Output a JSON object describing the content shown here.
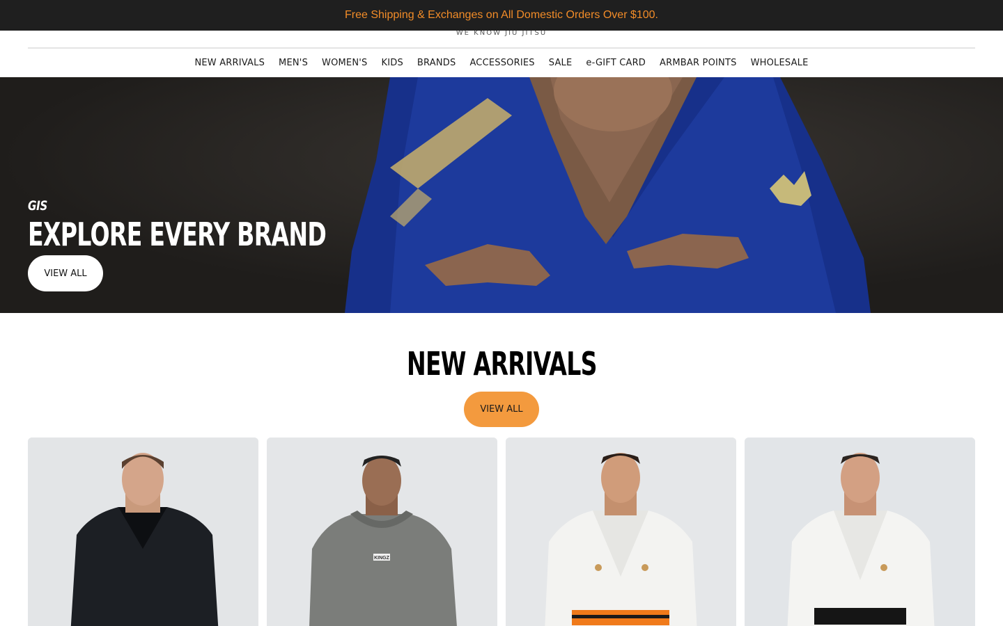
{
  "announcement": {
    "text": "Free Shipping & Exchanges on All Domestic Orders Over $100."
  },
  "brand": {
    "tagline": "WE KNOW JIU JITSU"
  },
  "nav": {
    "items": [
      {
        "label": "NEW ARRIVALS"
      },
      {
        "label": "MEN'S"
      },
      {
        "label": "WOMEN'S"
      },
      {
        "label": "KIDS"
      },
      {
        "label": "BRANDS"
      },
      {
        "label": "ACCESSORIES"
      },
      {
        "label": "SALE"
      },
      {
        "label": "e-GIFT CARD"
      },
      {
        "label": "ARMBAR POINTS"
      },
      {
        "label": "WHOLESALE"
      }
    ]
  },
  "hero": {
    "kicker": "GIS",
    "heading": "EXPLORE EVERY BRAND",
    "button_label": "VIEW ALL"
  },
  "new_arrivals": {
    "title": "NEW ARRIVALS",
    "button_label": "VIEW ALL",
    "products": [
      {
        "image": "man-black-jacket-image"
      },
      {
        "image": "man-grey-hoodie-image",
        "print": "KINGZ"
      },
      {
        "image": "man-white-gi-orange-belt-image"
      },
      {
        "image": "man-white-gi-black-belt-image"
      }
    ]
  },
  "colors": {
    "announcement_bg": "#1f1f1f",
    "announcement_text": "#f28c28",
    "accent_button": "#f39a3e"
  }
}
